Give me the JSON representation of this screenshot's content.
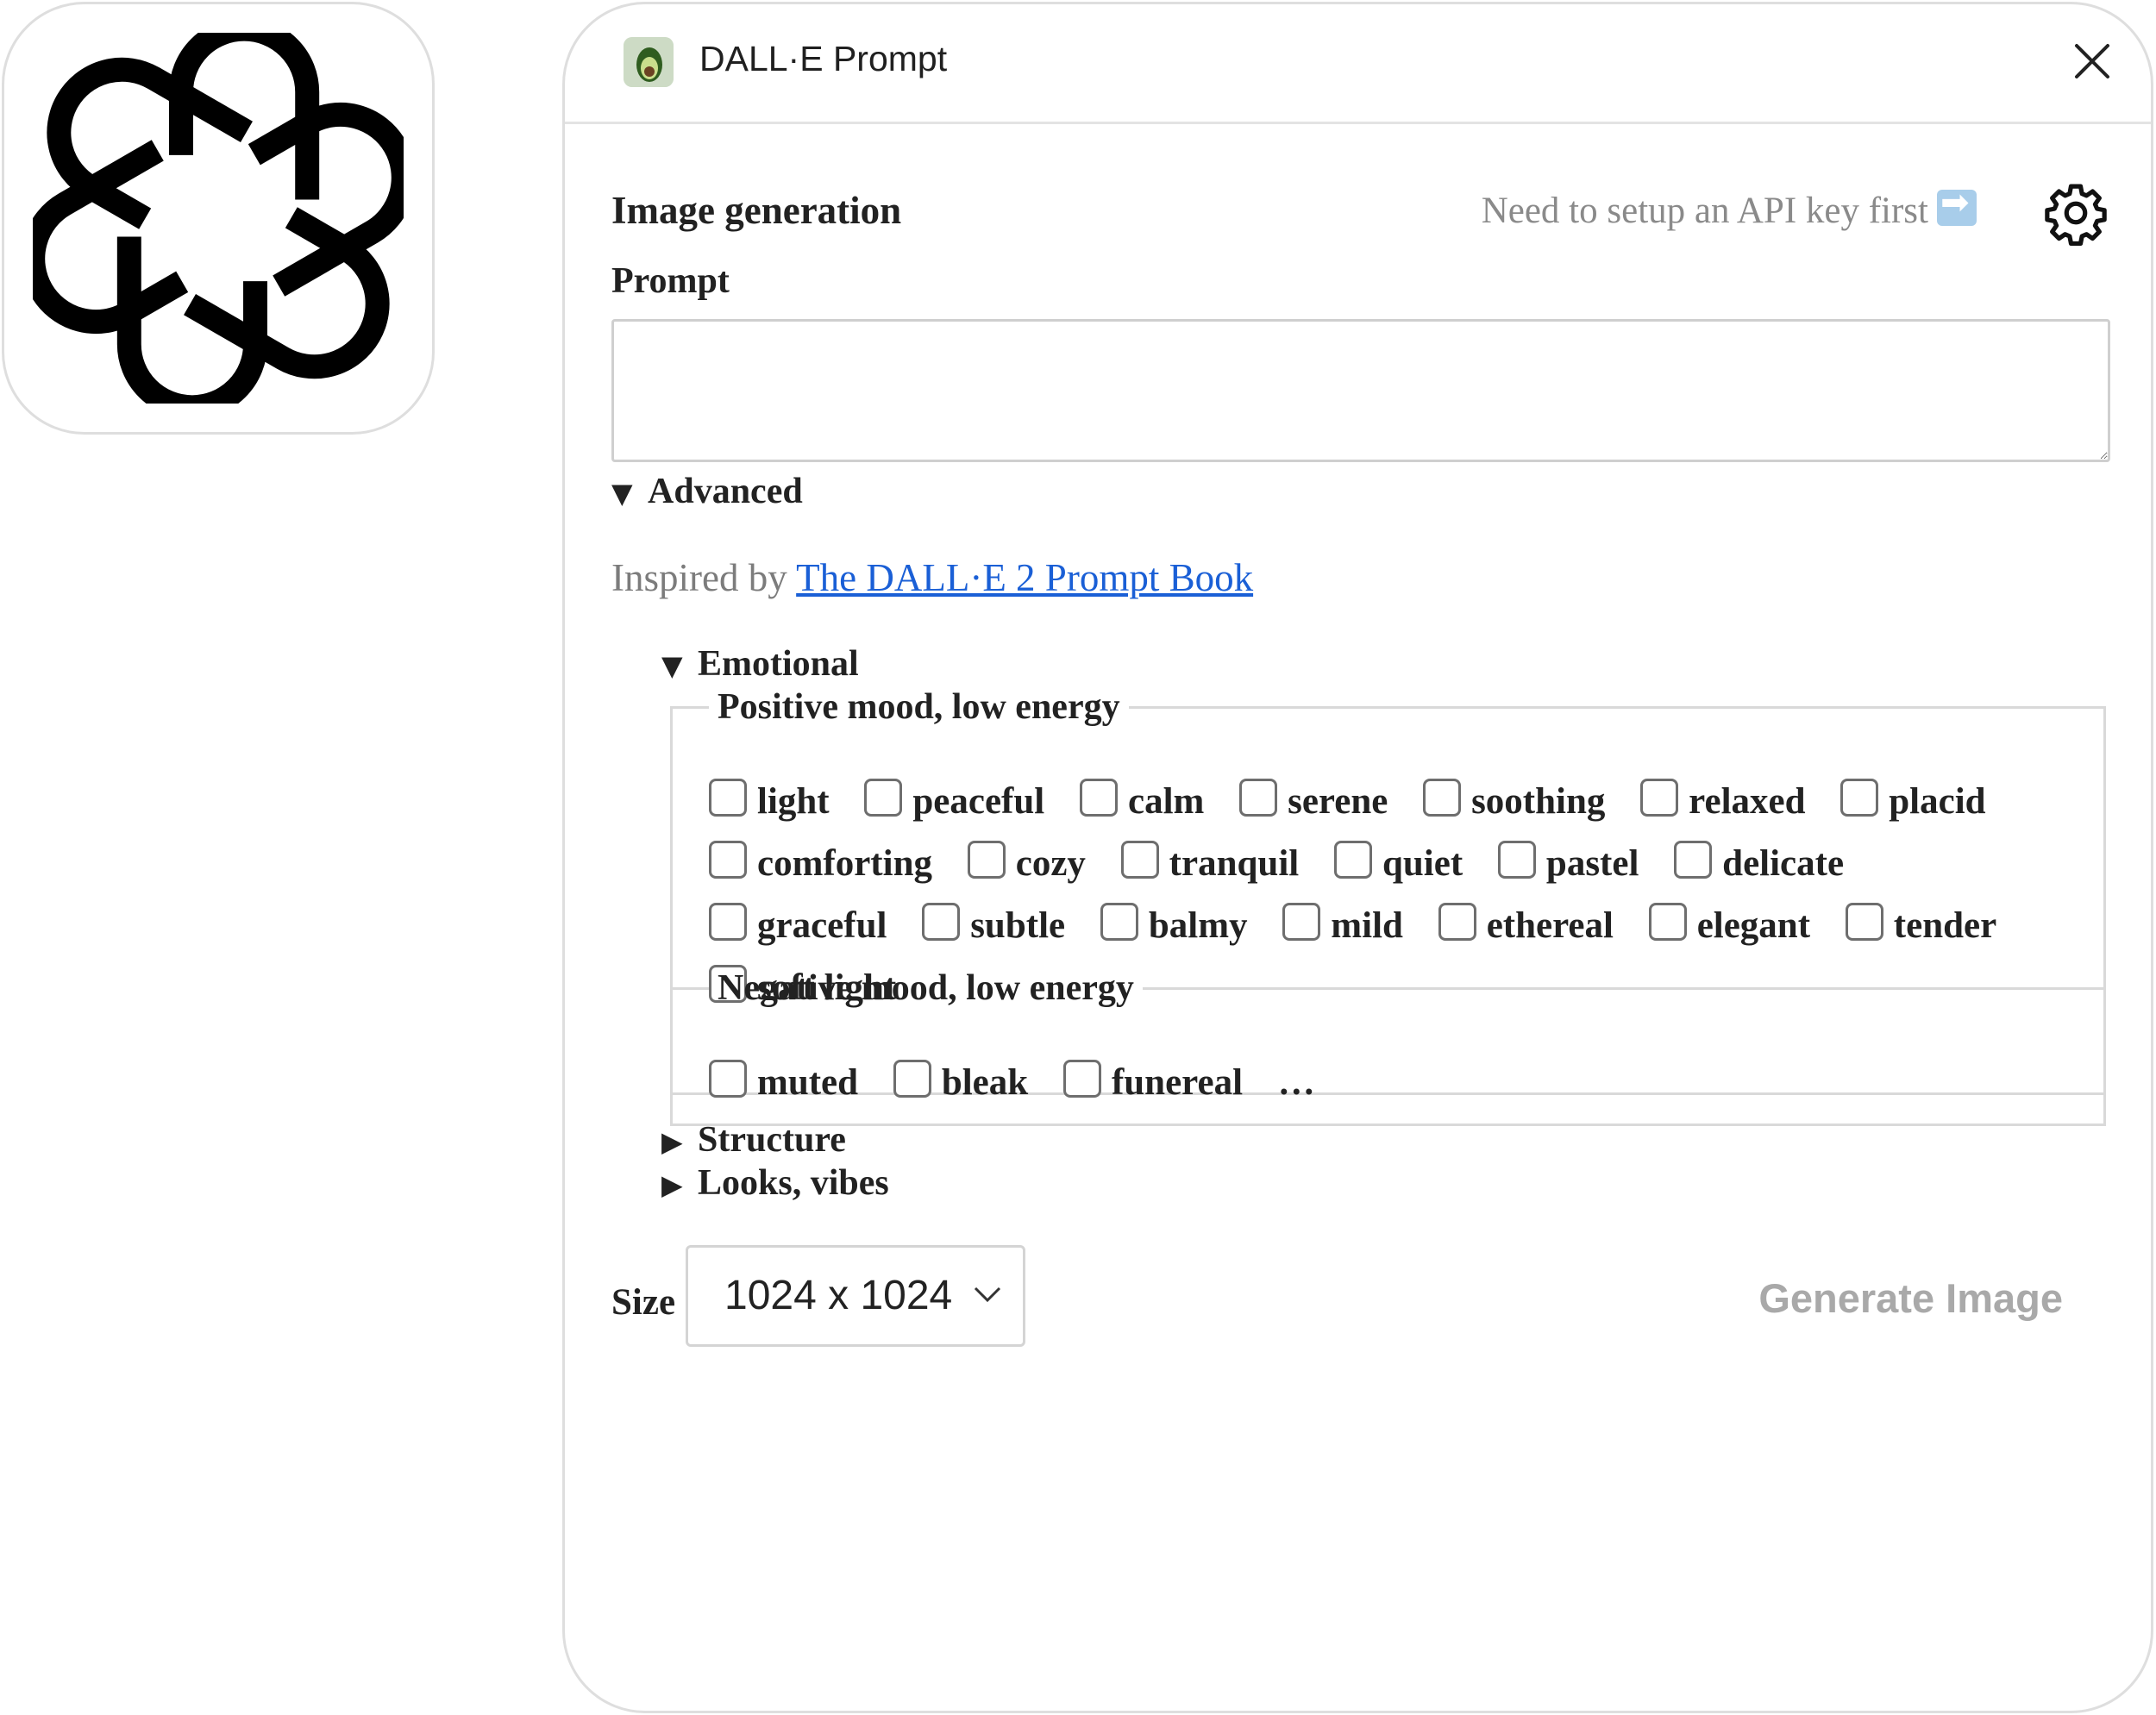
{
  "window": {
    "title": "DALL·E Prompt"
  },
  "header": {
    "section_title": "Image generation",
    "api_notice": "Need to setup an API key first"
  },
  "prompt": {
    "label": "Prompt",
    "value": "",
    "placeholder": ""
  },
  "advanced": {
    "label": "Advanced",
    "inspired_prefix": "Inspired by ",
    "inspired_link": "The DALL·E 2 Prompt Book",
    "emotional": {
      "label": "Emotional",
      "groups": [
        {
          "legend": "Positive mood, low energy",
          "options": [
            "light",
            "peaceful",
            "calm",
            "serene",
            "soothing",
            "relaxed",
            "placid",
            "comforting",
            "cozy",
            "tranquil",
            "quiet",
            "pastel",
            "delicate",
            "graceful",
            "subtle",
            "balmy",
            "mild",
            "ethereal",
            "elegant",
            "tender",
            "soft light"
          ]
        },
        {
          "legend": "Negative mood, low energy",
          "options": [
            "muted",
            "bleak",
            "funereal"
          ],
          "ellipsis": "…"
        }
      ]
    },
    "structure": {
      "label": "Structure"
    },
    "looks": {
      "label": "Looks, vibes"
    }
  },
  "size": {
    "label": "Size",
    "selected": "1024 x 1024"
  },
  "generate": {
    "label": "Generate Image"
  },
  "icons": {
    "logo": "openai-logo-icon",
    "app": "avocado-app-icon",
    "close": "close-icon",
    "settings": "gear-icon",
    "api_arrow": "right-arrow-icon",
    "select": "chevron-down-icon"
  }
}
